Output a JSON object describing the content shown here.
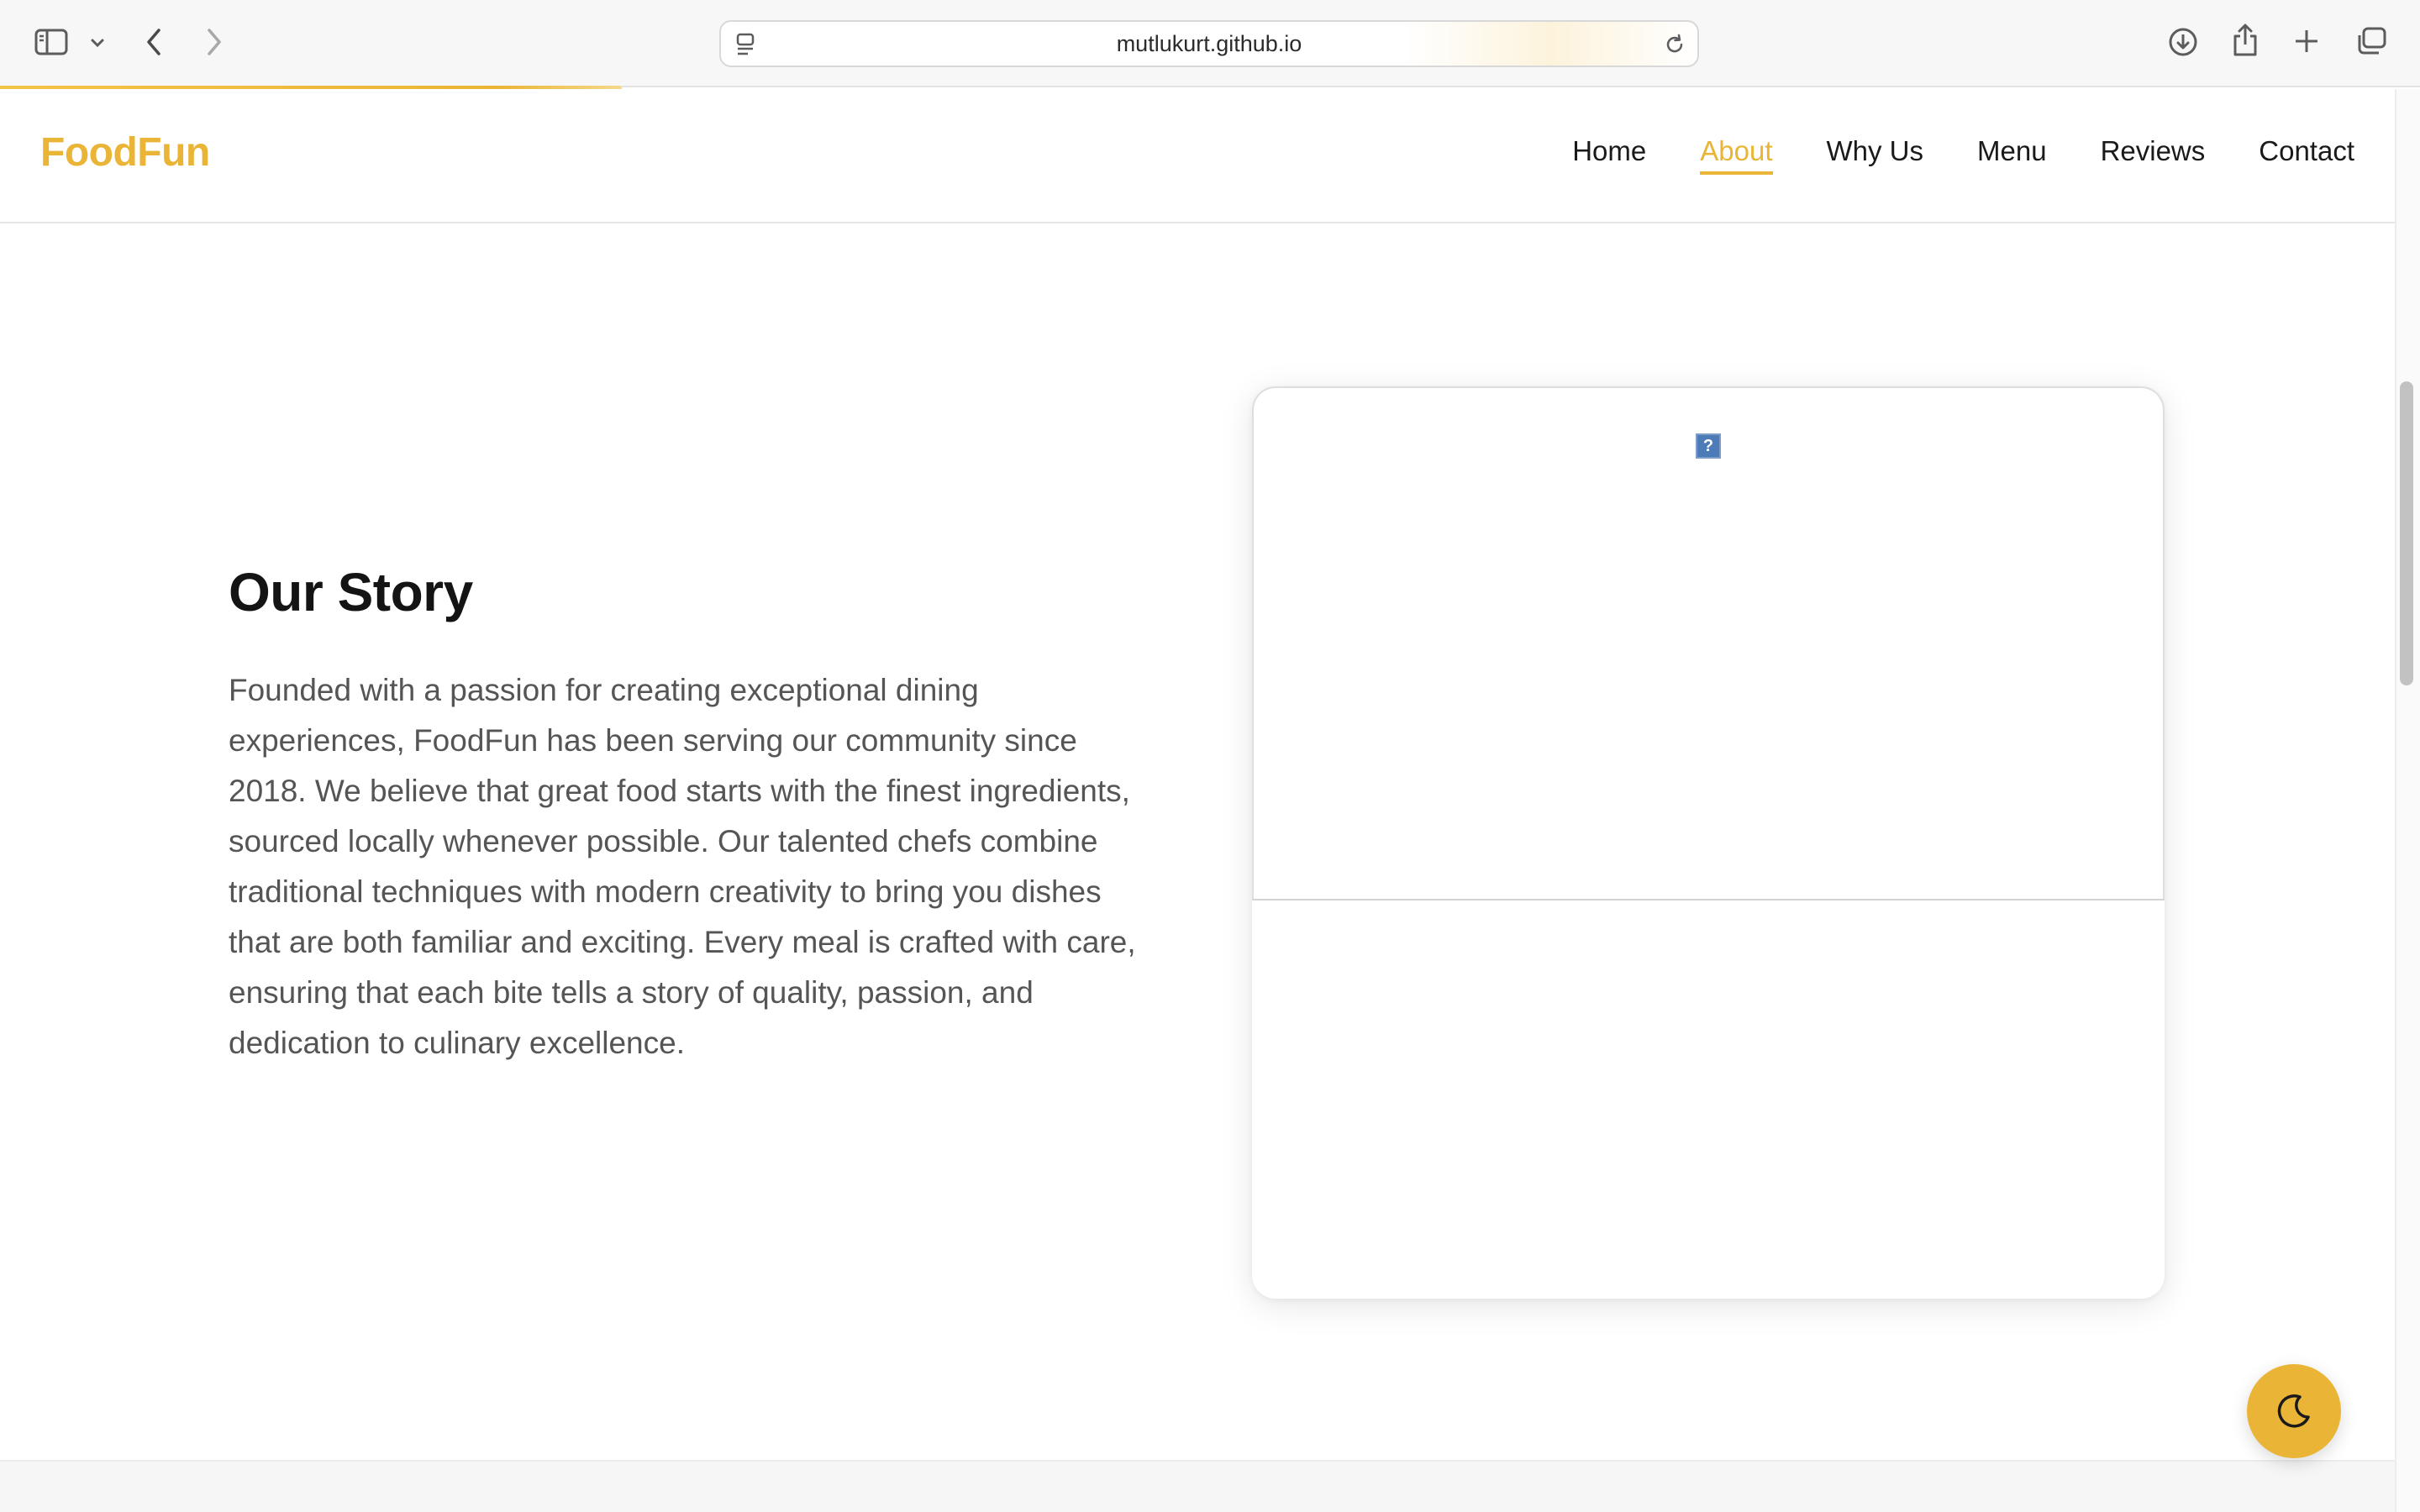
{
  "browser": {
    "url": "mutlukurt.github.io",
    "icons": {
      "sidebar": "sidebar-icon",
      "tab_menu": "chevron-down-icon",
      "back": "chevron-left-icon",
      "forward": "chevron-right-icon",
      "page_menu": "page-menu-icon",
      "reload": "reload-icon",
      "downloads": "download-icon",
      "share": "share-icon",
      "new_tab": "plus-icon",
      "tabs": "tabs-overview-icon"
    },
    "load_progress": 0.26
  },
  "site": {
    "brand": "FoodFun",
    "nav": [
      "Home",
      "About",
      "Why Us",
      "Menu",
      "Reviews",
      "Contact"
    ],
    "active_nav": "About"
  },
  "story": {
    "title": "Our Story",
    "body": "Founded with a passion for creating exceptional dining experiences, FoodFun has been serving our community since 2018. We believe that great food starts with the finest ingredients, sourced locally whenever possible. Our talented chefs combine traditional techniques with modern creativity to bring you dishes that are both familiar and exciting. Every meal is crafted with care, ensuring that each bite tells a story of quality, passion, and dedication to culinary excellence."
  },
  "image_card": {
    "broken_image_glyph": "?"
  },
  "theme_toggle": {
    "icon": "moon-icon"
  },
  "colors": {
    "accent": "#eab536",
    "text": "#1a1a1a",
    "body_text": "#555555",
    "chrome_bg": "#f7f7f7"
  }
}
